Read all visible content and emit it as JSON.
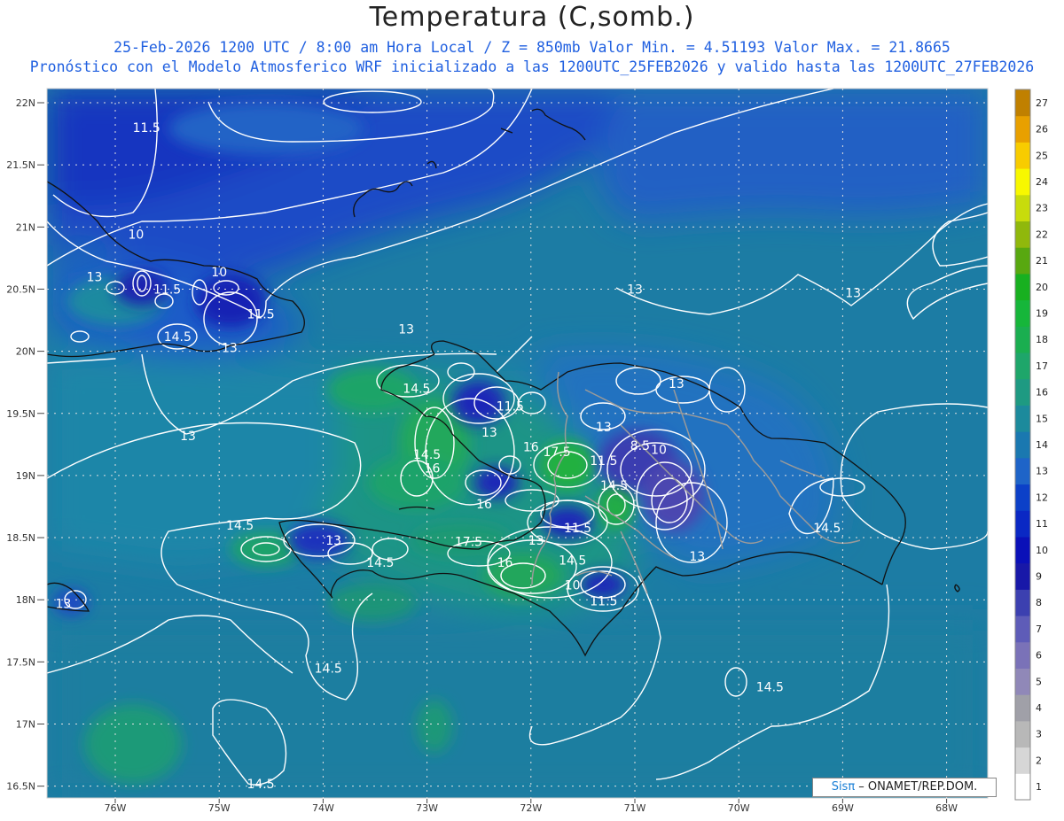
{
  "title": "Temperatura (C,somb.)",
  "subtitle_line1": "25-Feb-2026  1200 UTC / 8:00 am Hora Local / Z = 850mb    Valor Min. = 4.51193  Valor Max. = 21.8665",
  "subtitle_line2": "Pronóstico con el Modelo Atmosferico WRF inicializado a las 1200UTC_25FEB2026 y valido hasta las  1200UTC_27FEB2026",
  "credit": {
    "brand": "Sisπ",
    "text": " – ONAMET/REP.DOM."
  },
  "lat_labels": [
    "22N",
    "21.5N",
    "21N",
    "20.5N",
    "20N",
    "19.5N",
    "19N",
    "18.5N",
    "18N",
    "17.5N",
    "17N",
    "16.5N"
  ],
  "lon_labels": [
    "76W",
    "75W",
    "74W",
    "73W",
    "72W",
    "71W",
    "70W",
    "69W",
    "68W"
  ],
  "colorbar": {
    "levels": [
      1,
      2,
      3,
      4,
      5,
      6,
      7,
      8,
      9,
      10,
      11,
      12,
      13,
      14,
      15,
      16,
      17,
      18,
      19,
      20,
      21,
      22,
      23,
      24,
      25,
      26,
      27
    ],
    "colors": [
      "#ffffff",
      "#d6d6d6",
      "#b8b8b8",
      "#a0a0a8",
      "#9088b8",
      "#7a72b8",
      "#5e5cb8",
      "#3c40b0",
      "#1818a8",
      "#0a10b8",
      "#0a28c4",
      "#0c40c8",
      "#1e64c8",
      "#1a78b0",
      "#1c8a9c",
      "#1e9a82",
      "#1ea66a",
      "#1aae50",
      "#16b63a",
      "#18b020",
      "#58a810",
      "#90b80c",
      "#c8dc0c",
      "#f8f800",
      "#f8cc00",
      "#e8a000",
      "#c08000"
    ]
  },
  "contour_labels": [
    {
      "text": "11.5",
      "lon": -75.7,
      "lat": 21.8
    },
    {
      "text": "10",
      "lon": -75.8,
      "lat": 20.94
    },
    {
      "text": "13",
      "lon": -76.2,
      "lat": 20.6
    },
    {
      "text": "11.5",
      "lon": -75.5,
      "lat": 20.5
    },
    {
      "text": "10",
      "lon": -75.0,
      "lat": 20.64
    },
    {
      "text": "11.5",
      "lon": -74.6,
      "lat": 20.3
    },
    {
      "text": "14.5",
      "lon": -75.4,
      "lat": 20.12
    },
    {
      "text": "13",
      "lon": -74.9,
      "lat": 20.03
    },
    {
      "text": "13",
      "lon": -73.2,
      "lat": 20.18
    },
    {
      "text": "13",
      "lon": -71.0,
      "lat": 20.5
    },
    {
      "text": "13",
      "lon": -68.9,
      "lat": 20.47
    },
    {
      "text": "13",
      "lon": -75.3,
      "lat": 19.32
    },
    {
      "text": "14.5",
      "lon": -73.1,
      "lat": 19.7
    },
    {
      "text": "11.5",
      "lon": -72.2,
      "lat": 19.56
    },
    {
      "text": "13",
      "lon": -72.4,
      "lat": 19.35
    },
    {
      "text": "13",
      "lon": -71.3,
      "lat": 19.39
    },
    {
      "text": "13",
      "lon": -70.6,
      "lat": 19.74
    },
    {
      "text": "16",
      "lon": -72.0,
      "lat": 19.23
    },
    {
      "text": "17.5",
      "lon": -71.75,
      "lat": 19.19
    },
    {
      "text": "8.5",
      "lon": -70.95,
      "lat": 19.24
    },
    {
      "text": "10",
      "lon": -70.77,
      "lat": 19.21
    },
    {
      "text": "11.5",
      "lon": -71.3,
      "lat": 19.12
    },
    {
      "text": "14.5",
      "lon": -73.0,
      "lat": 19.17
    },
    {
      "text": "16",
      "lon": -72.95,
      "lat": 19.06
    },
    {
      "text": "14.5",
      "lon": -71.2,
      "lat": 18.92
    },
    {
      "text": "16",
      "lon": -72.45,
      "lat": 18.77
    },
    {
      "text": "14.5",
      "lon": -74.8,
      "lat": 18.6
    },
    {
      "text": "13",
      "lon": -73.9,
      "lat": 18.48
    },
    {
      "text": "17.5",
      "lon": -72.6,
      "lat": 18.47
    },
    {
      "text": "13",
      "lon": -71.95,
      "lat": 18.48
    },
    {
      "text": "11.5",
      "lon": -71.55,
      "lat": 18.58
    },
    {
      "text": "14.5",
      "lon": -73.45,
      "lat": 18.3
    },
    {
      "text": "16",
      "lon": -72.25,
      "lat": 18.3
    },
    {
      "text": "14.5",
      "lon": -71.6,
      "lat": 18.32
    },
    {
      "text": "10",
      "lon": -71.6,
      "lat": 18.12
    },
    {
      "text": "11.5",
      "lon": -71.3,
      "lat": 17.99
    },
    {
      "text": "13",
      "lon": -70.4,
      "lat": 18.35
    },
    {
      "text": "14.5",
      "lon": -69.15,
      "lat": 18.58
    },
    {
      "text": "13",
      "lon": -76.5,
      "lat": 17.97
    },
    {
      "text": "14.5",
      "lon": -73.95,
      "lat": 17.45
    },
    {
      "text": "14.5",
      "lon": -69.7,
      "lat": 17.3
    },
    {
      "text": "14.5",
      "lon": -74.6,
      "lat": 16.52
    }
  ]
}
